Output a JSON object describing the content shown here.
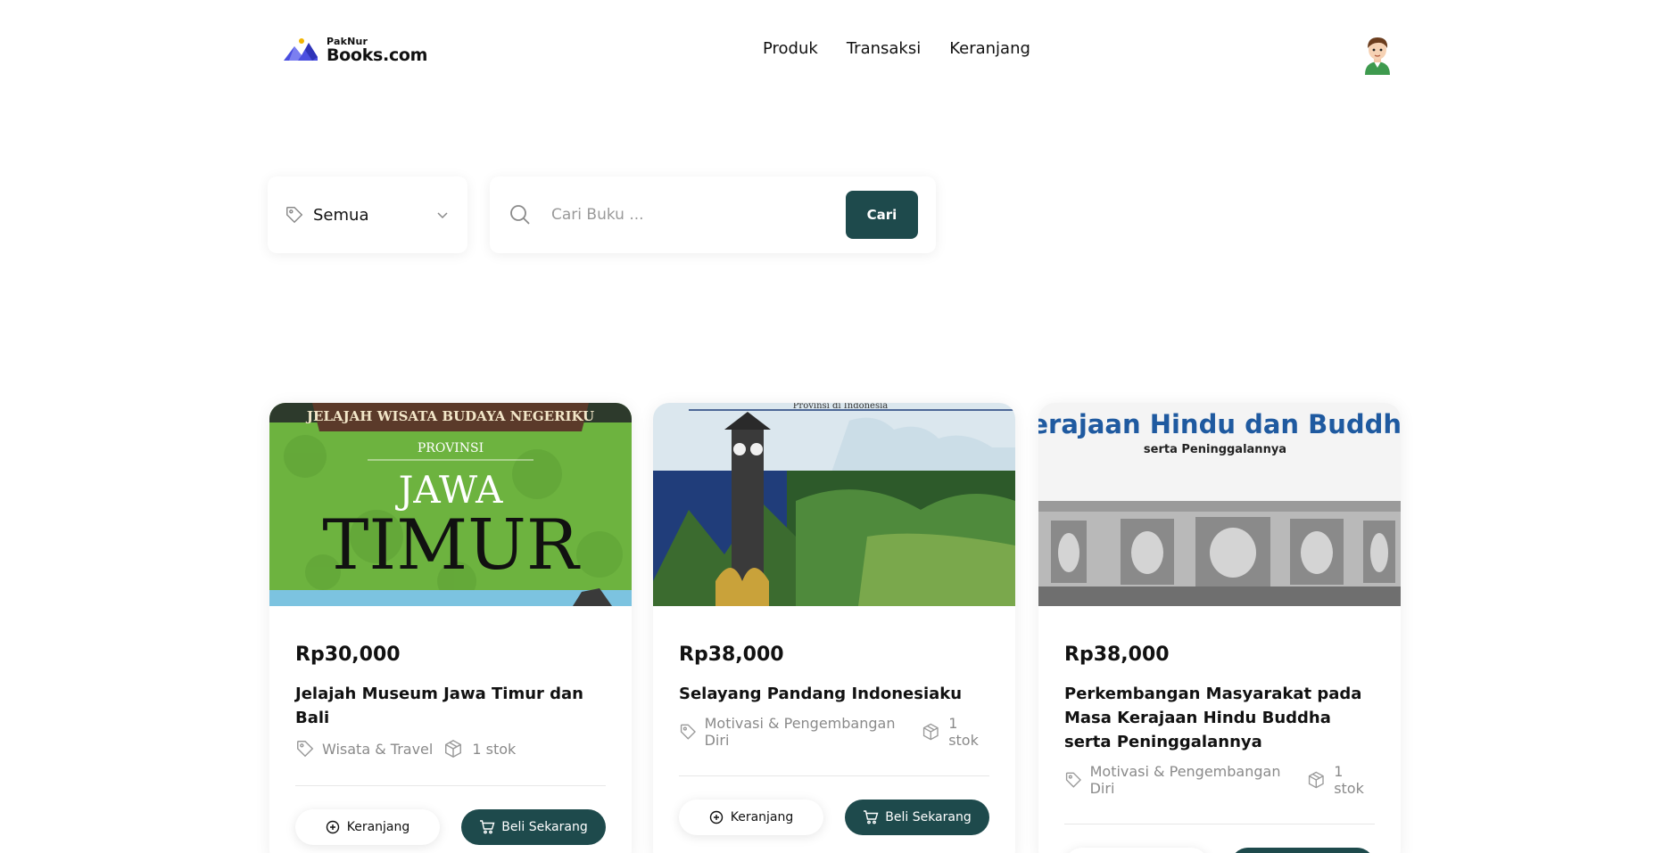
{
  "header": {
    "logo_small": "PakNur",
    "logo_big": "Books.com",
    "nav": [
      "Produk",
      "Transaksi",
      "Keranjang"
    ]
  },
  "filters": {
    "category_selected": "Semua",
    "search_placeholder": "Cari Buku ...",
    "search_button": "Cari"
  },
  "products": [
    {
      "price": "Rp30,000",
      "title": "Jelajah Museum Jawa Timur dan Bali",
      "category": "Wisata & Travel",
      "stock": "1 stok",
      "cover": {
        "banner": "JELAJAH WISATA BUDAYA NEGERIKU",
        "line1": "PROVINSI",
        "line2": "JAWA",
        "line3": "TIMUR"
      }
    },
    {
      "price": "Rp38,000",
      "title": "Selayang Pandang Indonesiaku",
      "category": "Motivasi & Pengembangan Diri",
      "stock": "1 stok",
      "cover": {
        "caption": "Provinsi di Indonesia"
      }
    },
    {
      "price": "Rp38,000",
      "title": "Perkembangan Masyarakat pada Masa Kerajaan Hindu Buddha serta Peninggalannya",
      "category": "Motivasi & Pengembangan Diri",
      "stock": "1 stok",
      "cover": {
        "heading": "Kerajaan Hindu dan Buddha",
        "subheading": "serta Peninggalannya"
      }
    }
  ],
  "actions": {
    "add_to_cart": "Keranjang",
    "buy_now": "Beli Sekarang"
  },
  "colors": {
    "primary": "#1e4a4c",
    "logo_accent": "#4a4fe0"
  },
  "icons": [
    "books-logo-icon",
    "user-avatar-icon",
    "tag-icon",
    "chevron-down-icon",
    "search-icon",
    "tag-icon",
    "box-icon",
    "plus-circle-icon",
    "cart-icon"
  ]
}
